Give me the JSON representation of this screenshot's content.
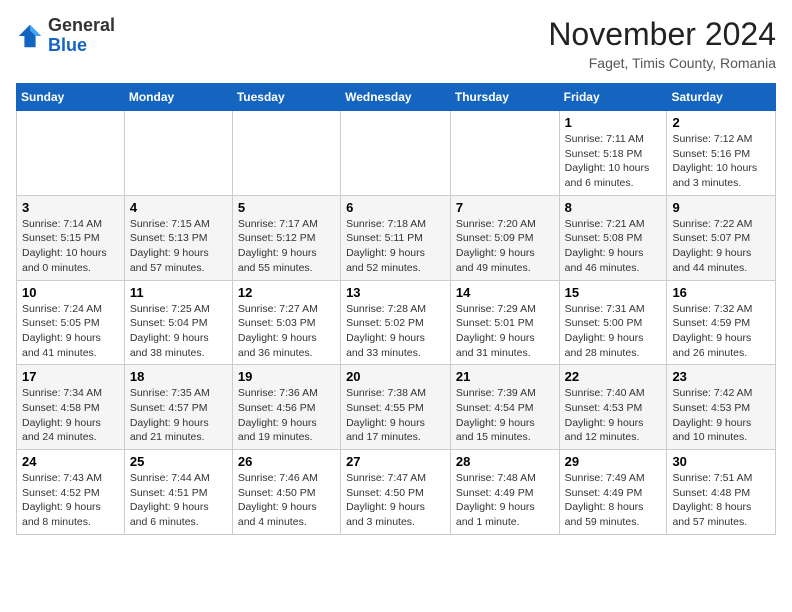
{
  "logo": {
    "general": "General",
    "blue": "Blue"
  },
  "title": "November 2024",
  "location": "Faget, Timis County, Romania",
  "days_of_week": [
    "Sunday",
    "Monday",
    "Tuesday",
    "Wednesday",
    "Thursday",
    "Friday",
    "Saturday"
  ],
  "weeks": [
    [
      {
        "day": "",
        "info": ""
      },
      {
        "day": "",
        "info": ""
      },
      {
        "day": "",
        "info": ""
      },
      {
        "day": "",
        "info": ""
      },
      {
        "day": "",
        "info": ""
      },
      {
        "day": "1",
        "info": "Sunrise: 7:11 AM\nSunset: 5:18 PM\nDaylight: 10 hours and 6 minutes."
      },
      {
        "day": "2",
        "info": "Sunrise: 7:12 AM\nSunset: 5:16 PM\nDaylight: 10 hours and 3 minutes."
      }
    ],
    [
      {
        "day": "3",
        "info": "Sunrise: 7:14 AM\nSunset: 5:15 PM\nDaylight: 10 hours and 0 minutes."
      },
      {
        "day": "4",
        "info": "Sunrise: 7:15 AM\nSunset: 5:13 PM\nDaylight: 9 hours and 57 minutes."
      },
      {
        "day": "5",
        "info": "Sunrise: 7:17 AM\nSunset: 5:12 PM\nDaylight: 9 hours and 55 minutes."
      },
      {
        "day": "6",
        "info": "Sunrise: 7:18 AM\nSunset: 5:11 PM\nDaylight: 9 hours and 52 minutes."
      },
      {
        "day": "7",
        "info": "Sunrise: 7:20 AM\nSunset: 5:09 PM\nDaylight: 9 hours and 49 minutes."
      },
      {
        "day": "8",
        "info": "Sunrise: 7:21 AM\nSunset: 5:08 PM\nDaylight: 9 hours and 46 minutes."
      },
      {
        "day": "9",
        "info": "Sunrise: 7:22 AM\nSunset: 5:07 PM\nDaylight: 9 hours and 44 minutes."
      }
    ],
    [
      {
        "day": "10",
        "info": "Sunrise: 7:24 AM\nSunset: 5:05 PM\nDaylight: 9 hours and 41 minutes."
      },
      {
        "day": "11",
        "info": "Sunrise: 7:25 AM\nSunset: 5:04 PM\nDaylight: 9 hours and 38 minutes."
      },
      {
        "day": "12",
        "info": "Sunrise: 7:27 AM\nSunset: 5:03 PM\nDaylight: 9 hours and 36 minutes."
      },
      {
        "day": "13",
        "info": "Sunrise: 7:28 AM\nSunset: 5:02 PM\nDaylight: 9 hours and 33 minutes."
      },
      {
        "day": "14",
        "info": "Sunrise: 7:29 AM\nSunset: 5:01 PM\nDaylight: 9 hours and 31 minutes."
      },
      {
        "day": "15",
        "info": "Sunrise: 7:31 AM\nSunset: 5:00 PM\nDaylight: 9 hours and 28 minutes."
      },
      {
        "day": "16",
        "info": "Sunrise: 7:32 AM\nSunset: 4:59 PM\nDaylight: 9 hours and 26 minutes."
      }
    ],
    [
      {
        "day": "17",
        "info": "Sunrise: 7:34 AM\nSunset: 4:58 PM\nDaylight: 9 hours and 24 minutes."
      },
      {
        "day": "18",
        "info": "Sunrise: 7:35 AM\nSunset: 4:57 PM\nDaylight: 9 hours and 21 minutes."
      },
      {
        "day": "19",
        "info": "Sunrise: 7:36 AM\nSunset: 4:56 PM\nDaylight: 9 hours and 19 minutes."
      },
      {
        "day": "20",
        "info": "Sunrise: 7:38 AM\nSunset: 4:55 PM\nDaylight: 9 hours and 17 minutes."
      },
      {
        "day": "21",
        "info": "Sunrise: 7:39 AM\nSunset: 4:54 PM\nDaylight: 9 hours and 15 minutes."
      },
      {
        "day": "22",
        "info": "Sunrise: 7:40 AM\nSunset: 4:53 PM\nDaylight: 9 hours and 12 minutes."
      },
      {
        "day": "23",
        "info": "Sunrise: 7:42 AM\nSunset: 4:53 PM\nDaylight: 9 hours and 10 minutes."
      }
    ],
    [
      {
        "day": "24",
        "info": "Sunrise: 7:43 AM\nSunset: 4:52 PM\nDaylight: 9 hours and 8 minutes."
      },
      {
        "day": "25",
        "info": "Sunrise: 7:44 AM\nSunset: 4:51 PM\nDaylight: 9 hours and 6 minutes."
      },
      {
        "day": "26",
        "info": "Sunrise: 7:46 AM\nSunset: 4:50 PM\nDaylight: 9 hours and 4 minutes."
      },
      {
        "day": "27",
        "info": "Sunrise: 7:47 AM\nSunset: 4:50 PM\nDaylight: 9 hours and 3 minutes."
      },
      {
        "day": "28",
        "info": "Sunrise: 7:48 AM\nSunset: 4:49 PM\nDaylight: 9 hours and 1 minute."
      },
      {
        "day": "29",
        "info": "Sunrise: 7:49 AM\nSunset: 4:49 PM\nDaylight: 8 hours and 59 minutes."
      },
      {
        "day": "30",
        "info": "Sunrise: 7:51 AM\nSunset: 4:48 PM\nDaylight: 8 hours and 57 minutes."
      }
    ]
  ]
}
